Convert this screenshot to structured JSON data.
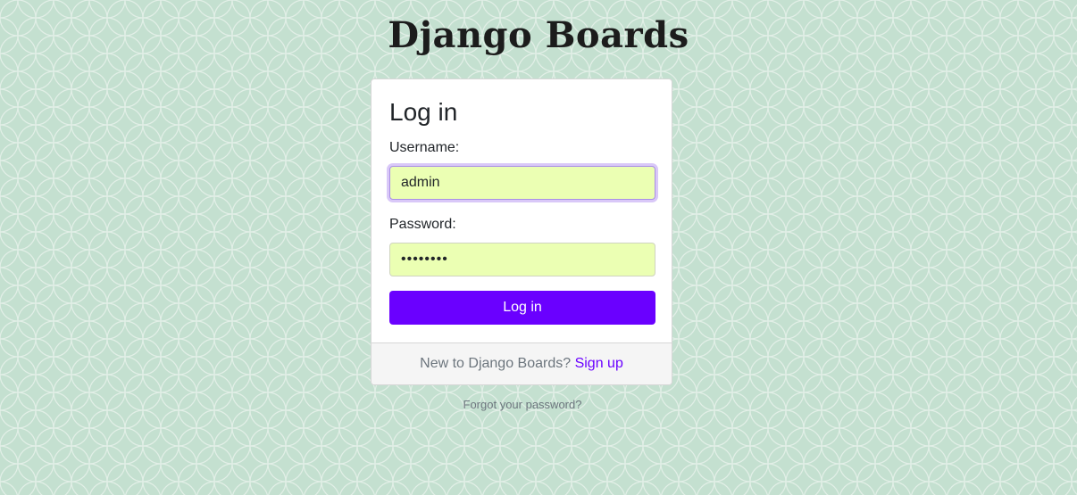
{
  "brand": {
    "title": "Django Boards"
  },
  "login_card": {
    "title": "Log in",
    "username_label": "Username:",
    "username_value": "admin",
    "password_label": "Password:",
    "password_value": "password",
    "submit_label": "Log in"
  },
  "footer": {
    "prompt": "New to Django Boards?",
    "signup_link": "Sign up"
  },
  "forgot_password_link": "Forgot your password?",
  "colors": {
    "background": "#c4e0d0",
    "pattern_lines": "#e2efe7",
    "field_background": "#ebffb3",
    "accent": "#6a00ff",
    "focus_ring": "#d9c8f8",
    "footer_background": "#f5f5f5"
  }
}
